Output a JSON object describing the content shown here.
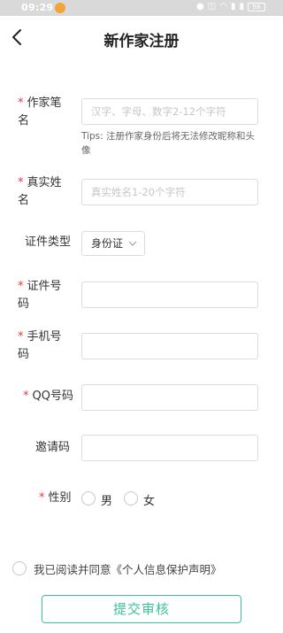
{
  "status_bar": {
    "time": "09:29",
    "battery": "58"
  },
  "header": {
    "title": "新作家注册"
  },
  "form": {
    "pen_name": {
      "label_line1": "作家笔",
      "label_line2": "名",
      "placeholder": "汉字、字母、数字2-12个字符",
      "tips_line1": "Tips: 注册作家身份后将无法修改昵称和头",
      "tips_line2": "像"
    },
    "real_name": {
      "label_line1": "真实姓",
      "label_line2": "名",
      "placeholder": "真实姓名1-20个字符"
    },
    "id_type": {
      "label": "证件类型",
      "selected": "身份证"
    },
    "id_number": {
      "label_line1": "证件号",
      "label_line2": "码",
      "placeholder": ""
    },
    "phone": {
      "label_line1": "手机号",
      "label_line2": "码",
      "placeholder": ""
    },
    "qq": {
      "label": "QQ号码",
      "placeholder": ""
    },
    "invite_code": {
      "label": "邀请码",
      "placeholder": ""
    },
    "gender": {
      "label": "性别",
      "options": [
        "男",
        "女"
      ]
    }
  },
  "agreement": {
    "text": "我已阅读并同意《个人信息保护声明》"
  },
  "submit": {
    "label": "提交审核"
  },
  "colors": {
    "accent": "#39c39a",
    "required": "#e23a3a",
    "status_bar": "#d9d9d9"
  }
}
